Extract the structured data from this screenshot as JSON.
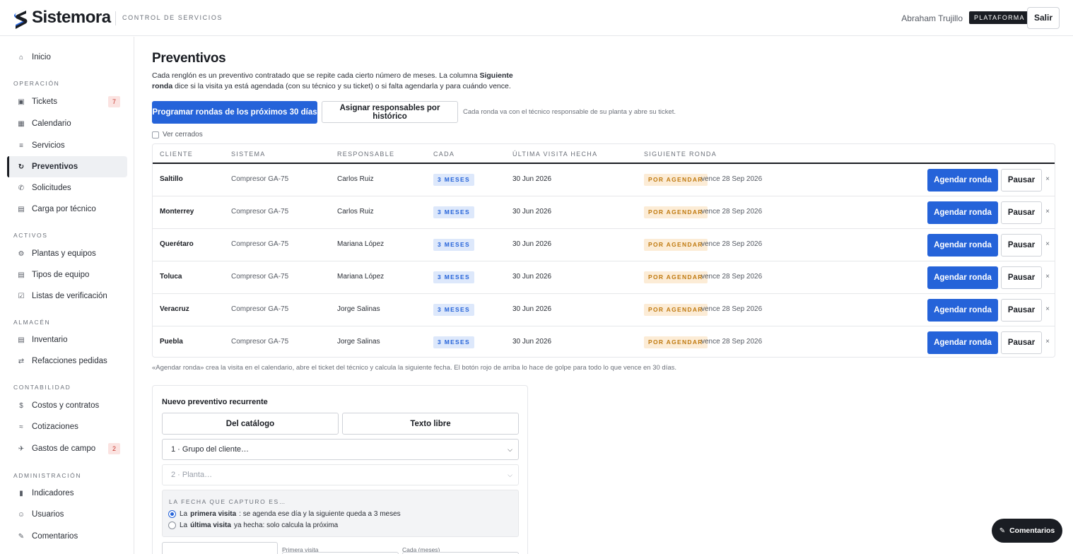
{
  "header": {
    "brand": "Sistemora",
    "subtitle": "CONTROL DE SERVICIOS",
    "user_name": "Abraham Trujillo",
    "role_badge": "PLATAFORMA",
    "logout_label": "Salir"
  },
  "sidebar": {
    "home": {
      "label": "Inicio",
      "icon": "home-icon"
    },
    "sections": [
      {
        "title": "OPERACIÓN"
      },
      {
        "title": "ACTIVOS"
      },
      {
        "title": "ALMACÉN"
      },
      {
        "title": "CONTABILIDAD"
      },
      {
        "title": "ADMINISTRACIÓN"
      }
    ],
    "items": [
      {
        "label": "Tickets",
        "count": "7",
        "icon": "ticket-icon"
      },
      {
        "label": "Calendario",
        "icon": "calendar-icon"
      },
      {
        "label": "Servicios",
        "icon": "list-icon"
      },
      {
        "label": "Preventivos",
        "icon": "refresh-icon",
        "active": true
      },
      {
        "label": "Solicitudes",
        "icon": "request-icon"
      },
      {
        "label": "Carga por técnico",
        "icon": "workload-icon"
      },
      {
        "label": "Plantas y equipos",
        "icon": "gear-icon"
      },
      {
        "label": "Tipos de equipo",
        "icon": "equipment-type-icon"
      },
      {
        "label": "Listas de verificación",
        "icon": "checklist-icon"
      },
      {
        "label": "Inventario",
        "icon": "inventory-icon"
      },
      {
        "label": "Refacciones pedidas",
        "icon": "swap-icon"
      },
      {
        "label": "Costos y contratos",
        "icon": "dollar-icon"
      },
      {
        "label": "Cotizaciones",
        "icon": "quote-icon"
      },
      {
        "label": "Gastos de campo",
        "count": "2",
        "icon": "plane-icon"
      },
      {
        "label": "Indicadores",
        "icon": "bar-chart-icon"
      },
      {
        "label": "Usuarios",
        "icon": "users-icon"
      },
      {
        "label": "Comentarios",
        "icon": "pencil-icon"
      }
    ]
  },
  "main": {
    "title": "Preventivos",
    "desc_part1": "Cada renglón es un preventivo contratado que se repite cada cierto número de meses. La columna ",
    "desc_bold": "Siguiente ronda",
    "desc_part2": " dice si la visita ya está agendada (con su técnico y su ticket) o si falta agendarla y para cuándo vence.",
    "primary_action": "Programar rondas de los próximos 30 días",
    "secondary_action": "Asignar responsables por histórico",
    "hint": "Cada ronda va con el técnico responsable de su planta y abre su ticket.",
    "show_closed_label": "Ver cerrados",
    "footnote": "«Agendar ronda» crea la visita en el calendario, abre el ticket del técnico y calcula la siguiente fecha. El botón rojo de arriba lo hace de golpe para todo lo que vence en 30 días."
  },
  "table": {
    "columns": [
      "CLIENTE",
      "SISTEMA",
      "RESPONSABLE",
      "CADA",
      "ÚLTIMA VISITA HECHA",
      "SIGUIENTE RONDA"
    ],
    "schedule_label": "Agendar ronda",
    "pause_label": "Pausar",
    "close_label": "×",
    "rows": [
      {
        "client": "Saltillo",
        "system": "Compresor GA-75",
        "responsible": "Carlos Ruiz",
        "frequency": "3 MESES",
        "last_visit": "30 Jun 2026",
        "status": "POR AGENDAR",
        "due": "vence 28 Sep 2026"
      },
      {
        "client": "Monterrey",
        "system": "Compresor GA-75",
        "responsible": "Carlos Ruiz",
        "frequency": "3 MESES",
        "last_visit": "30 Jun 2026",
        "status": "POR AGENDAR",
        "due": "vence 28 Sep 2026"
      },
      {
        "client": "Querétaro",
        "system": "Compresor GA-75",
        "responsible": "Mariana López",
        "frequency": "3 MESES",
        "last_visit": "30 Jun 2026",
        "status": "POR AGENDAR",
        "due": "vence 28 Sep 2026"
      },
      {
        "client": "Toluca",
        "system": "Compresor GA-75",
        "responsible": "Mariana López",
        "frequency": "3 MESES",
        "last_visit": "30 Jun 2026",
        "status": "POR AGENDAR",
        "due": "vence 28 Sep 2026"
      },
      {
        "client": "Veracruz",
        "system": "Compresor GA-75",
        "responsible": "Jorge Salinas",
        "frequency": "3 MESES",
        "last_visit": "30 Jun 2026",
        "status": "POR AGENDAR",
        "due": "vence 28 Sep 2026"
      },
      {
        "client": "Puebla",
        "system": "Compresor GA-75",
        "responsible": "Jorge Salinas",
        "frequency": "3 MESES",
        "last_visit": "30 Jun 2026",
        "status": "POR AGENDAR",
        "due": "vence 28 Sep 2026"
      }
    ]
  },
  "form": {
    "title": "Nuevo preventivo recurrente",
    "tab_catalog": "Del catálogo",
    "tab_free_text": "Texto libre",
    "group_select": "1 · Grupo del cliente…",
    "plant_select": "2 · Planta…",
    "date_title": "LA FECHA QUE CAPTURO ES…",
    "radio1_prefix": "La",
    "radio1_bold": "primera visita",
    "radio1_suffix": ": se agenda ese día y la siguiente queda a 3 meses",
    "radio2_prefix": "La",
    "radio2_bold": "última visita",
    "radio2_suffix": "ya hecha: solo calcula la próxima",
    "first_visit_label": "Primera visita",
    "every_months_label": "Cada (meses)"
  },
  "floating": {
    "feedback_label": "Comentarios",
    "icon": "pencil-icon"
  },
  "colors": {
    "primary": "#2563d9",
    "dark": "#1a1d23",
    "warning_bg": "#fcecd6",
    "warning_text": "#c07a10",
    "info_bg": "#dde8fb",
    "danger_bg": "#fbe3e1"
  }
}
